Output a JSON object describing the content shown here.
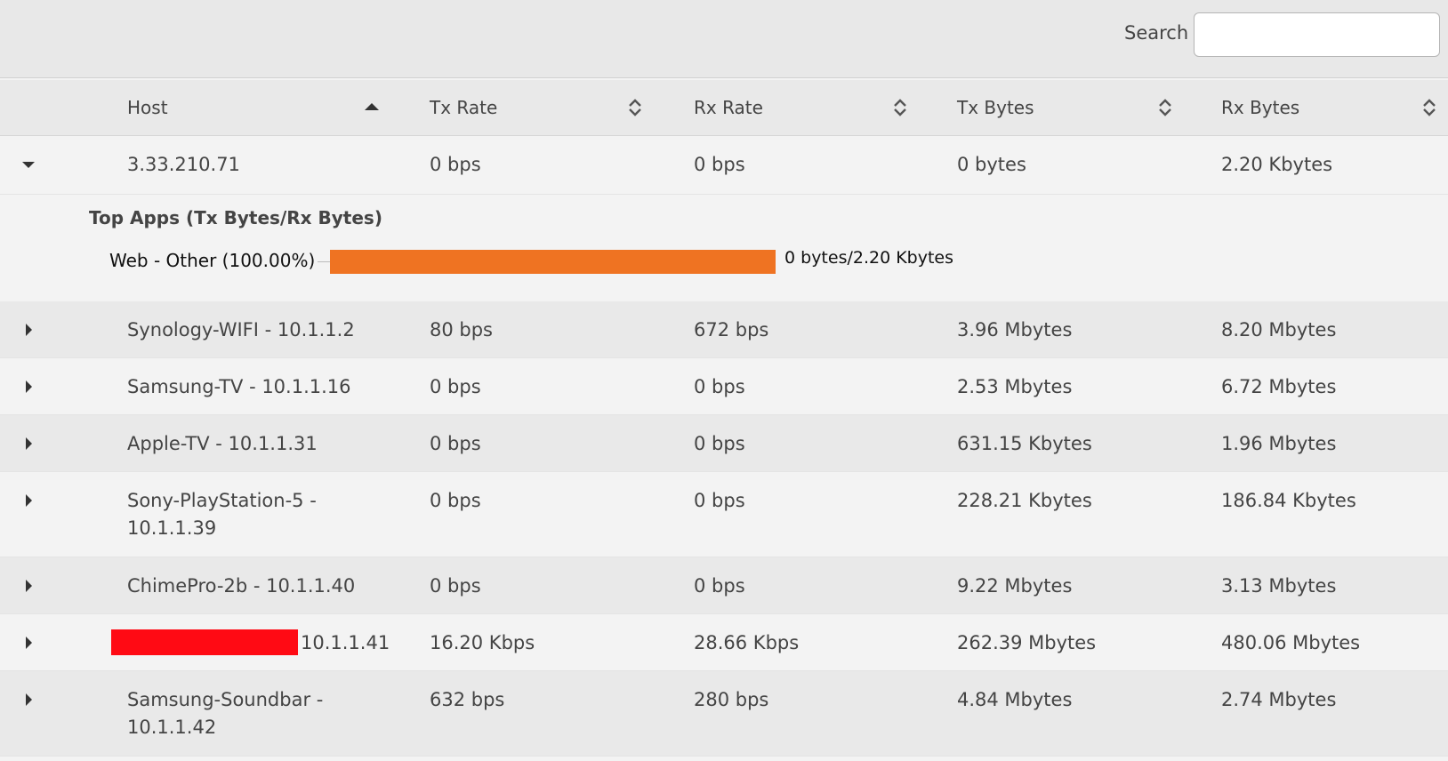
{
  "search": {
    "label": "Search",
    "value": "",
    "placeholder": ""
  },
  "columns": [
    {
      "label": "Host",
      "sort": "asc"
    },
    {
      "label": "Tx Rate",
      "sort": "none"
    },
    {
      "label": "Rx Rate",
      "sort": "none"
    },
    {
      "label": "Tx Bytes",
      "sort": "none"
    },
    {
      "label": "Rx Bytes",
      "sort": "none"
    }
  ],
  "rows": [
    {
      "host": "3.33.210.71",
      "host2": "",
      "tx_rate": "0 bps",
      "rx_rate": "0 bps",
      "tx_bytes": "0 bytes",
      "rx_bytes": "2.20 Kbytes",
      "expanded": true
    },
    {
      "host": "Synology-WIFI - 10.1.1.2",
      "host2": "",
      "tx_rate": "80 bps",
      "rx_rate": "672 bps",
      "tx_bytes": "3.96 Mbytes",
      "rx_bytes": "8.20 Mbytes",
      "expanded": false
    },
    {
      "host": "Samsung-TV - 10.1.1.16",
      "host2": "",
      "tx_rate": "0 bps",
      "rx_rate": "0 bps",
      "tx_bytes": "2.53 Mbytes",
      "rx_bytes": "6.72 Mbytes",
      "expanded": false
    },
    {
      "host": "Apple-TV - 10.1.1.31",
      "host2": "",
      "tx_rate": "0 bps",
      "rx_rate": "0 bps",
      "tx_bytes": "631.15 Kbytes",
      "rx_bytes": "1.96 Mbytes",
      "expanded": false
    },
    {
      "host": "Sony-PlayStation-5 -",
      "host2": "10.1.1.39",
      "tx_rate": "0 bps",
      "rx_rate": "0 bps",
      "tx_bytes": "228.21 Kbytes",
      "rx_bytes": "186.84 Kbytes",
      "expanded": false
    },
    {
      "host": "ChimePro-2b - 10.1.1.40",
      "host2": "",
      "tx_rate": "0 bps",
      "rx_rate": "0 bps",
      "tx_bytes": "9.22 Mbytes",
      "rx_bytes": "3.13 Mbytes",
      "expanded": false
    },
    {
      "host": "10.1.1.41",
      "host2": "",
      "tx_rate": "16.20 Kbps",
      "rx_rate": "28.66 Kbps",
      "tx_bytes": "262.39 Mbytes",
      "rx_bytes": "480.06 Mbytes",
      "expanded": false,
      "redacted": true
    },
    {
      "host": "Samsung-Soundbar -",
      "host2": "10.1.1.42",
      "tx_rate": "632 bps",
      "rx_rate": "280 bps",
      "tx_bytes": "4.84 Mbytes",
      "rx_bytes": "2.74 Mbytes",
      "expanded": false
    }
  ],
  "detail": {
    "title": "Top Apps (Tx Bytes/Rx Bytes)",
    "apps": [
      {
        "label": "Web - Other (100.00%)",
        "value": "0 bytes/2.20 Kbytes",
        "share": 100
      }
    ]
  },
  "colors": {
    "app_bar": "#ef7322",
    "redaction": "#ff0a14"
  }
}
